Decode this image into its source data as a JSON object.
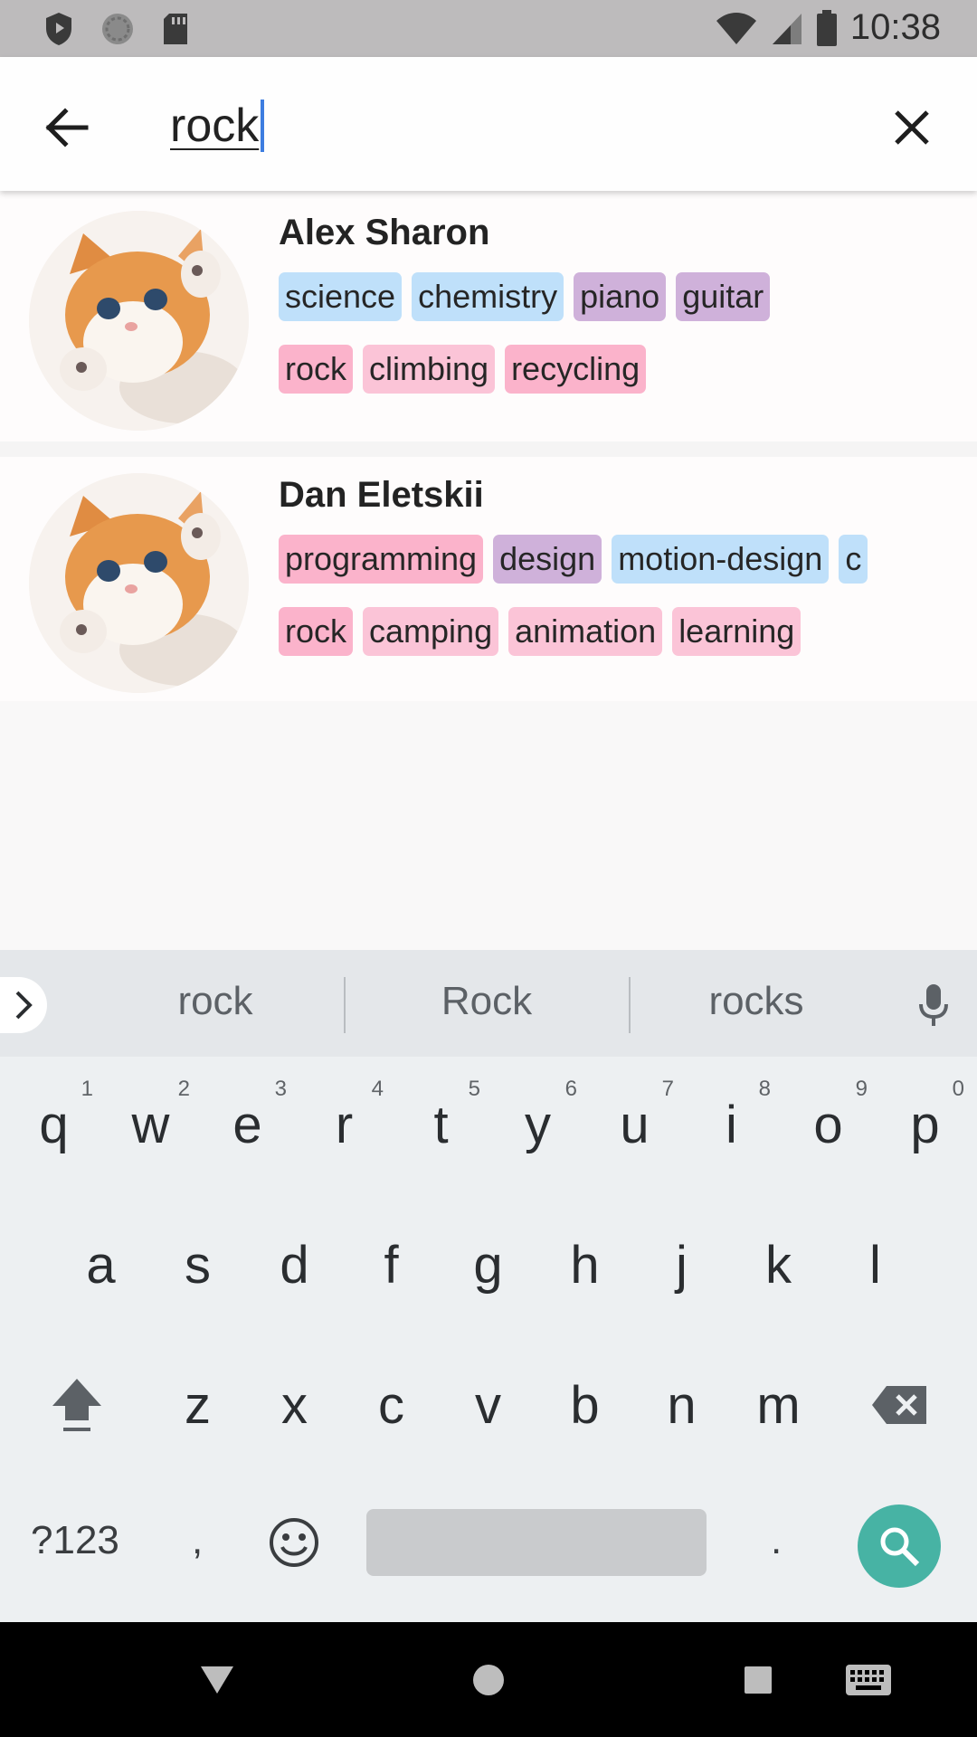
{
  "status_bar": {
    "time": "10:38",
    "icons": [
      "shield-icon",
      "sync-icon",
      "sd-card-icon",
      "wifi-icon",
      "signal-icon",
      "battery-icon"
    ]
  },
  "search": {
    "query": "rock",
    "back_icon": "arrow-back-icon",
    "clear_icon": "close-icon"
  },
  "results": [
    {
      "name": "Alex Sharon",
      "tag_rows": [
        [
          {
            "label": "science",
            "color": "#bfe0fa"
          },
          {
            "label": "chemistry",
            "color": "#bfe0fa"
          },
          {
            "label": "piano",
            "color": "#cfb1da"
          },
          {
            "label": "guitar",
            "color": "#cfb1da"
          }
        ],
        [
          {
            "label": "rock",
            "color": "#fbb3cb"
          },
          {
            "label": "climbing",
            "color": "#fbc4d7"
          },
          {
            "label": "recycling",
            "color": "#fbb3cb"
          }
        ]
      ]
    },
    {
      "name": "Dan Eletskii",
      "tag_rows": [
        [
          {
            "label": "programming",
            "color": "#fbb3cb"
          },
          {
            "label": "design",
            "color": "#cfb1da"
          },
          {
            "label": "motion-design",
            "color": "#bfe0fa"
          },
          {
            "label": "c",
            "color": "#bfe0fa"
          }
        ],
        [
          {
            "label": "rock",
            "color": "#fbb3cb"
          },
          {
            "label": "camping",
            "color": "#fbc4d7"
          },
          {
            "label": "animation",
            "color": "#fbc4d7"
          },
          {
            "label": "learning",
            "color": "#fbc4d7"
          }
        ]
      ]
    }
  ],
  "keyboard": {
    "suggestions": [
      "rock",
      "Rock",
      "rocks"
    ],
    "row1": [
      {
        "key": "q",
        "hint": "1"
      },
      {
        "key": "w",
        "hint": "2"
      },
      {
        "key": "e",
        "hint": "3"
      },
      {
        "key": "r",
        "hint": "4"
      },
      {
        "key": "t",
        "hint": "5"
      },
      {
        "key": "y",
        "hint": "6"
      },
      {
        "key": "u",
        "hint": "7"
      },
      {
        "key": "i",
        "hint": "8"
      },
      {
        "key": "o",
        "hint": "9"
      },
      {
        "key": "p",
        "hint": "0"
      }
    ],
    "row2": [
      "a",
      "s",
      "d",
      "f",
      "g",
      "h",
      "j",
      "k",
      "l"
    ],
    "row3": [
      "z",
      "x",
      "c",
      "v",
      "b",
      "n",
      "m"
    ],
    "symbols_label": "?123",
    "comma": ",",
    "period": ".",
    "accent_color": "#47b3a4"
  }
}
